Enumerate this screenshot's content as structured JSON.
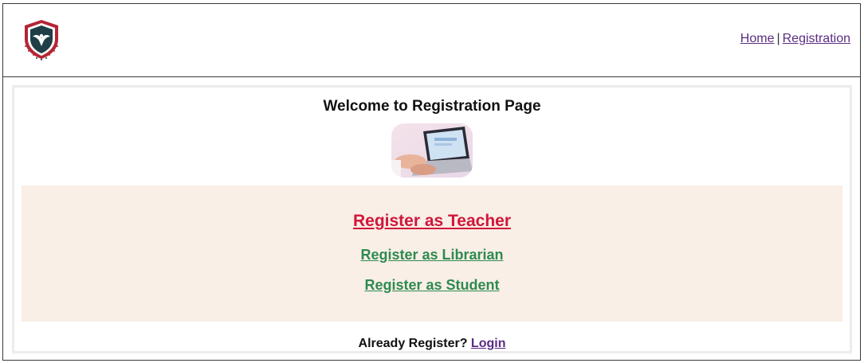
{
  "header": {
    "logo_icon": "eagle-shield-icon",
    "nav": {
      "home": "Home",
      "separator": "|",
      "registration": "Registration"
    }
  },
  "main": {
    "title": "Welcome to Registration Page",
    "hero_image": "laptop-typing-image",
    "links": {
      "teacher": "Register as Teacher",
      "librarian": "Register as Librarian",
      "student": "Register as Student"
    },
    "footer": {
      "prompt": "Already Register?",
      "login": "Login"
    }
  },
  "colors": {
    "teacher_link": "#d0163b",
    "secondary_link": "#2e8a50",
    "nav_link": "#5a2d82",
    "panel_bg": "#f9efe6"
  }
}
